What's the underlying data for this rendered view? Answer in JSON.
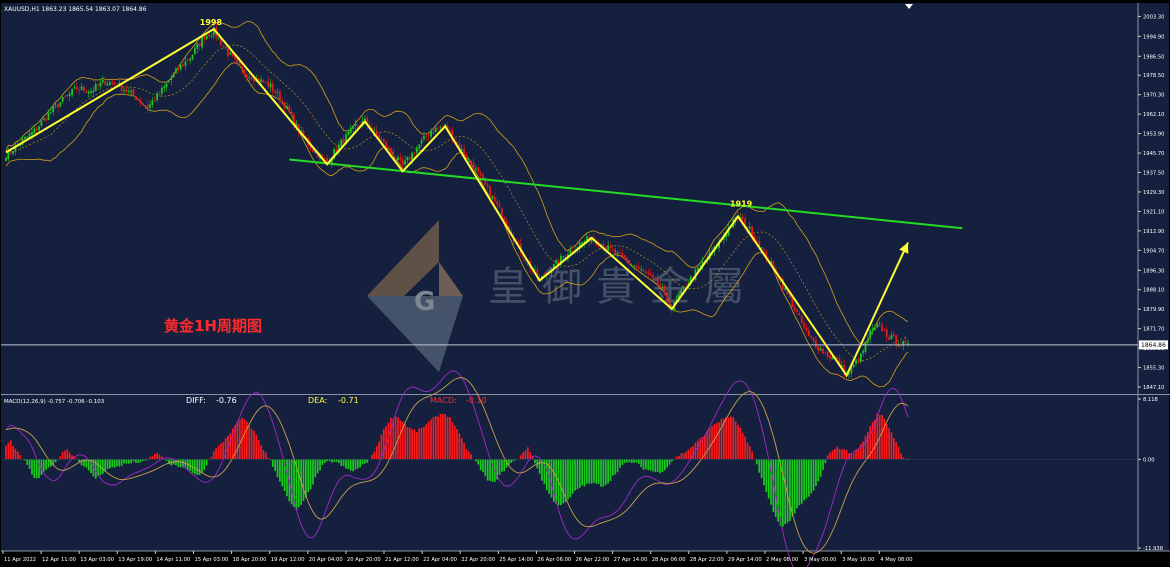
{
  "header": {
    "symbol_line": "XAUUSD,H1  1863.23 1865.54 1863.07 1864.86"
  },
  "chart_data": [
    {
      "type": "candlestick",
      "title": "黄金1H周期图",
      "symbol": "XAUUSD,H1",
      "ohlc_header": {
        "open": 1863.23,
        "high": 1865.54,
        "low": 1863.07,
        "close": 1864.86
      },
      "current_price_label": "1864.86",
      "y_ticks": [
        "2003.30",
        "1994.90",
        "1986.50",
        "1978.50",
        "1970.30",
        "1962.10",
        "1953.90",
        "1945.70",
        "1937.50",
        "1929.30",
        "1921.10",
        "1912.90",
        "1904.70",
        "1896.30",
        "1888.10",
        "1879.90",
        "1871.70",
        "1863.50",
        "1855.30",
        "1847.10"
      ],
      "ylim": [
        1845,
        2006
      ],
      "x_ticks": [
        "11 Apr 2022",
        "12 Apr 11:00",
        "13 Apr 03:00",
        "13 Apr 19:00",
        "14 Apr 11:00",
        "15 Apr 03:00",
        "18 Apr 20:00",
        "19 Apr 12:00",
        "20 Apr 04:00",
        "20 Apr 20:00",
        "21 Apr 12:00",
        "22 Apr 04:00",
        "22 Apr 20:00",
        "25 Apr 14:00",
        "26 Apr 06:00",
        "26 Apr 22:00",
        "27 Apr 14:00",
        "28 Apr 06:00",
        "28 Apr 22:00",
        "29 Apr 14:00",
        "2 May 08:00",
        "3 May 00:00",
        "3 May 16:00",
        "4 May 08:00"
      ],
      "zigzag_annotations": [
        "1998",
        "1919"
      ],
      "close_path": [
        [
          0,
          1945
        ],
        [
          6,
          1950
        ],
        [
          12,
          1955
        ],
        [
          18,
          1962
        ],
        [
          24,
          1968
        ],
        [
          30,
          1973
        ],
        [
          36,
          1972
        ],
        [
          42,
          1976
        ],
        [
          48,
          1974
        ],
        [
          54,
          1970
        ],
        [
          60,
          1965
        ],
        [
          66,
          1972
        ],
        [
          72,
          1980
        ],
        [
          78,
          1986
        ],
        [
          84,
          1995
        ],
        [
          88,
          1997
        ],
        [
          94,
          1988
        ],
        [
          100,
          1980
        ],
        [
          106,
          1977
        ],
        [
          112,
          1974
        ],
        [
          118,
          1966
        ],
        [
          124,
          1955
        ],
        [
          130,
          1947
        ],
        [
          136,
          1942
        ],
        [
          142,
          1950
        ],
        [
          148,
          1957
        ],
        [
          152,
          1959
        ],
        [
          158,
          1952
        ],
        [
          164,
          1945
        ],
        [
          168,
          1940
        ],
        [
          174,
          1948
        ],
        [
          180,
          1955
        ],
        [
          186,
          1957
        ],
        [
          192,
          1948
        ],
        [
          198,
          1940
        ],
        [
          204,
          1930
        ],
        [
          210,
          1920
        ],
        [
          216,
          1908
        ],
        [
          222,
          1898
        ],
        [
          226,
          1892
        ],
        [
          232,
          1898
        ],
        [
          238,
          1904
        ],
        [
          244,
          1908
        ],
        [
          248,
          1910
        ],
        [
          254,
          1906
        ],
        [
          260,
          1902
        ],
        [
          266,
          1898
        ],
        [
          272,
          1894
        ],
        [
          278,
          1888
        ],
        [
          282,
          1880
        ],
        [
          288,
          1890
        ],
        [
          294,
          1898
        ],
        [
          300,
          1905
        ],
        [
          306,
          1914
        ],
        [
          310,
          1919
        ],
        [
          316,
          1912
        ],
        [
          322,
          1902
        ],
        [
          328,
          1892
        ],
        [
          334,
          1880
        ],
        [
          340,
          1868
        ],
        [
          346,
          1862
        ],
        [
          352,
          1858
        ],
        [
          356,
          1852
        ],
        [
          362,
          1860
        ],
        [
          366,
          1870
        ],
        [
          370,
          1873
        ],
        [
          374,
          1868
        ],
        [
          378,
          1866
        ],
        [
          382,
          1864
        ]
      ],
      "bollinger": {
        "period": 20,
        "stddev": 2
      },
      "zigzag_points": [
        [
          0,
          1946
        ],
        [
          88,
          1998
        ],
        [
          136,
          1941
        ],
        [
          152,
          1959
        ],
        [
          168,
          1938
        ],
        [
          186,
          1957
        ],
        [
          226,
          1892
        ],
        [
          248,
          1910
        ],
        [
          282,
          1880
        ],
        [
          310,
          1919
        ],
        [
          356,
          1852
        ],
        [
          382,
          1908
        ]
      ],
      "trendline": {
        "x1": 120,
        "y1": 1943,
        "x2": 405,
        "y2": 1914
      },
      "colors": {
        "up": "#1ec71e",
        "down": "#e21b1b",
        "trendline": "#22dd22",
        "zigzag": "#ffff33",
        "bands": "#d4a017",
        "background": "#15203e"
      }
    },
    {
      "type": "bar",
      "title": "MACD(12,26,9) -0.757 -0.706 -0.103",
      "diff_label": "DIFF:",
      "diff_value": "-0.76",
      "dea_label": "DEA:",
      "dea_value": "-0.71",
      "macd_label": "MACD:",
      "macd_value": "-0.10",
      "y_ticks": [
        "8.118",
        "0.00",
        "-11.938"
      ],
      "ylim": [
        -11.938,
        8.118
      ],
      "values": [
        1.8,
        2.5,
        1.2,
        0.3,
        -0.5,
        -1.8,
        -2.8,
        -2.2,
        -1.5,
        -0.8,
        -0.5,
        0.8,
        1.4,
        0.8,
        0.2,
        -0.6,
        -1.2,
        -2.0,
        -2.6,
        -2.0,
        -1.4,
        -1.2,
        -1.0,
        -0.8,
        -0.6,
        -0.5,
        -0.4,
        -0.4,
        -0.3,
        0.4,
        0.8,
        0.6,
        -0.4,
        -0.8,
        -0.9,
        -1.0,
        -1.3,
        -1.8,
        -2.2,
        -2.0,
        -0.8,
        0.5,
        1.5,
        2.1,
        3.0,
        3.8,
        4.8,
        5.6,
        5.0,
        4.2,
        3.2,
        1.8,
        0.6,
        -0.5,
        -2.0,
        -3.4,
        -5.0,
        -6.2,
        -6.8,
        -6.2,
        -5.0,
        -3.6,
        -2.2,
        -1.0,
        -0.4,
        -0.3,
        -0.4,
        -0.9,
        -1.3,
        -1.6,
        -1.4,
        -0.9,
        -0.4,
        0.4,
        1.8,
        3.4,
        4.8,
        5.6,
        5.8,
        5.2,
        4.5,
        4.0,
        3.8,
        4.2,
        4.8,
        5.4,
        5.8,
        6.2,
        6.0,
        5.2,
        4.0,
        2.6,
        1.4,
        0.4,
        -0.6,
        -1.6,
        -2.8,
        -3.2,
        -2.6,
        -1.8,
        -1.0,
        -0.4,
        -0.1,
        0.8,
        1.6,
        0.6,
        -1.2,
        -2.8,
        -4.2,
        -5.4,
        -6.0,
        -6.2,
        -5.6,
        -4.8,
        -4.0,
        -3.6,
        -3.4,
        -3.2,
        -3.4,
        -3.6,
        -3.3,
        -2.4,
        -1.6,
        -0.8,
        -0.5,
        -0.4,
        -0.6,
        -1.2,
        -1.4,
        -1.6,
        -1.8,
        -1.6,
        -1.0,
        -0.2,
        0.4,
        0.8,
        1.2,
        1.8,
        2.4,
        3.0,
        3.8,
        4.6,
        5.0,
        5.4,
        5.8,
        5.6,
        4.8,
        3.6,
        2.2,
        0.8,
        -1.0,
        -3.0,
        -5.0,
        -6.8,
        -8.4,
        -9.0,
        -8.6,
        -7.6,
        -6.6,
        -5.8,
        -5.2,
        -4.4,
        -3.2,
        -1.6,
        0.4,
        1.4,
        1.6,
        1.4,
        1.0,
        0.8,
        1.4,
        2.4,
        3.8,
        5.0,
        6.2,
        5.8,
        4.6,
        3.2,
        1.8,
        0.4,
        -0.1
      ],
      "colors": {
        "positive": "#ff1a1a",
        "negative": "#1ccc1c",
        "diff": "#a02ac8",
        "dea": "#c8a050"
      }
    }
  ],
  "watermark": {
    "chinese_text": "皇御貴金屬"
  }
}
